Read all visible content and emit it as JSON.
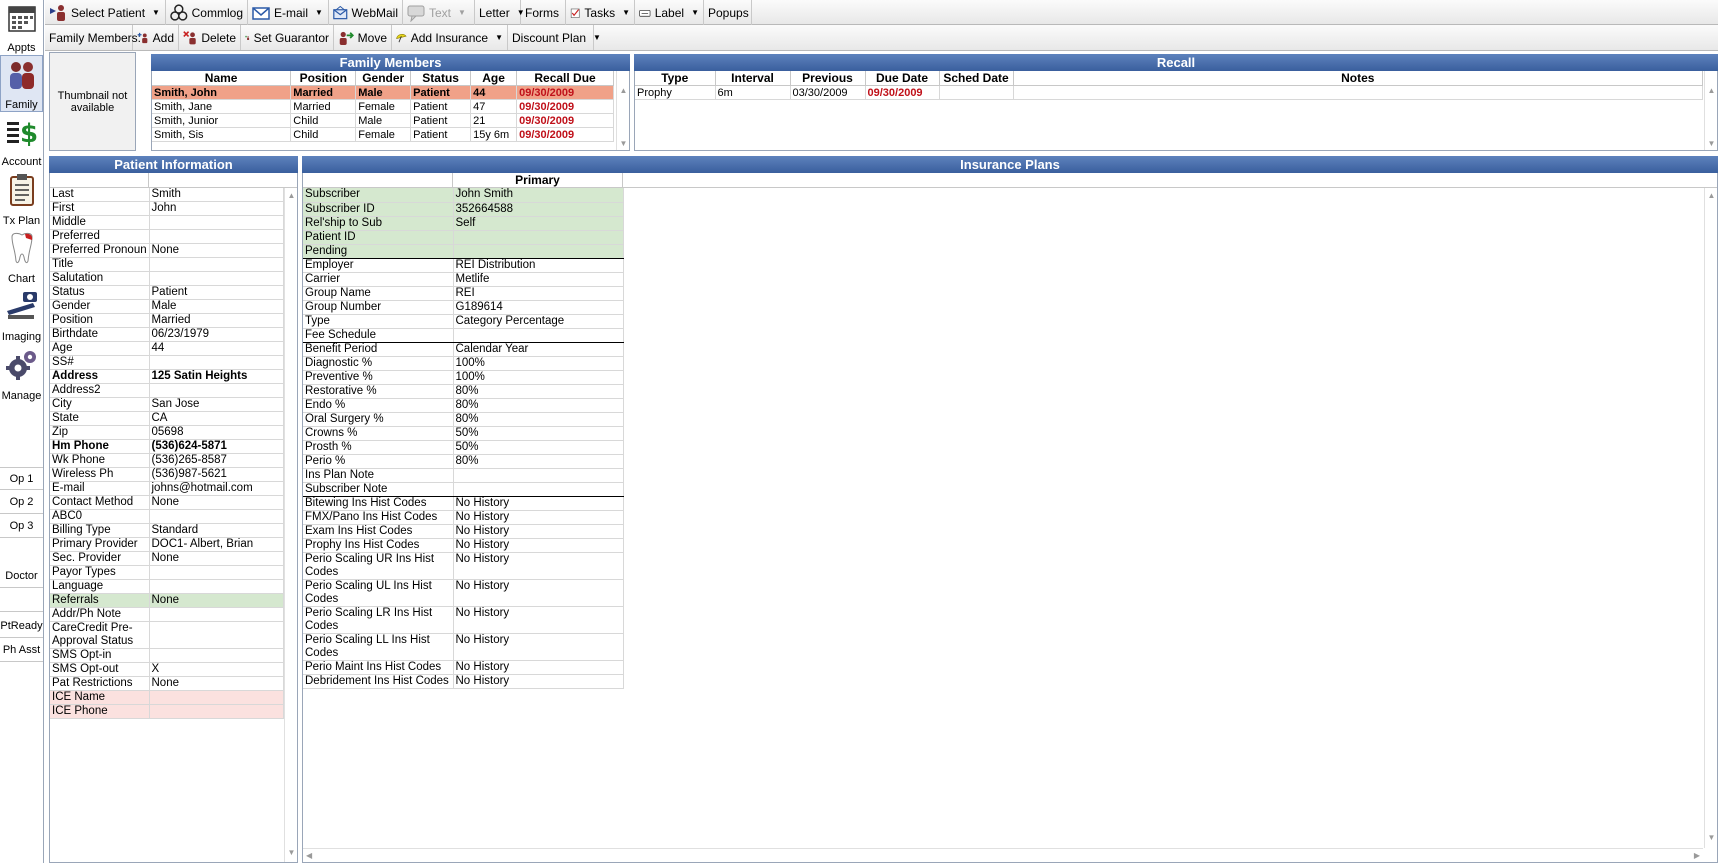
{
  "modules": [
    {
      "label": "Appts",
      "icon": "calendar-icon"
    },
    {
      "label": "Family",
      "icon": "family-icon"
    },
    {
      "label": "Account",
      "icon": "dollar-icon"
    },
    {
      "label": "Tx Plan",
      "icon": "clipboard-icon"
    },
    {
      "label": "Chart",
      "icon": "tooth-icon"
    },
    {
      "label": "Imaging",
      "icon": "camera-icon"
    },
    {
      "label": "Manage",
      "icon": "gears-icon"
    }
  ],
  "side_buttons": [
    "Op 1",
    "Op 2",
    "Op 3",
    "Doctor",
    "PtReady",
    "Ph Asst"
  ],
  "toolbar1": {
    "select_patient": "Select Patient",
    "commlog": "Commlog",
    "email": "E-mail",
    "webmail": "WebMail",
    "text": "Text",
    "letter": "Letter",
    "forms": "Forms",
    "tasks": "Tasks",
    "label": "Label",
    "popups": "Popups"
  },
  "toolbar2": {
    "family_members": "Family Members:",
    "add": "Add",
    "delete": "Delete",
    "set_guarantor": "Set Guarantor",
    "move": "Move",
    "add_insurance": "Add Insurance",
    "discount_plan": "Discount Plan"
  },
  "thumbnail_text": "Thumbnail not available",
  "family": {
    "title": "Family Members",
    "columns": [
      "Name",
      "Position",
      "Gender",
      "Status",
      "Age",
      "Recall Due"
    ],
    "rows": [
      [
        "Smith, John",
        "Married",
        "Male",
        "Patient",
        "44",
        "09/30/2009"
      ],
      [
        "Smith, Jane",
        "Married",
        "Female",
        "Patient",
        "47",
        "09/30/2009"
      ],
      [
        "Smith, Junior",
        "Child",
        "Male",
        "Patient",
        "21",
        "09/30/2009"
      ],
      [
        "Smith, Sis",
        "Child",
        "Female",
        "Patient",
        "15y 6m",
        "09/30/2009"
      ]
    ]
  },
  "recall": {
    "title": "Recall",
    "columns": [
      "Type",
      "Interval",
      "Previous",
      "Due Date",
      "Sched Date",
      "Notes"
    ],
    "rows": [
      [
        "Prophy",
        "6m",
        "03/30/2009",
        "09/30/2009",
        "",
        ""
      ]
    ]
  },
  "patient_info": {
    "title": "Patient Information",
    "rows": [
      {
        "k": "Last",
        "v": "Smith"
      },
      {
        "k": "First",
        "v": "John"
      },
      {
        "k": "Middle",
        "v": ""
      },
      {
        "k": "Preferred",
        "v": ""
      },
      {
        "k": "Preferred Pronoun",
        "v": "None"
      },
      {
        "k": "Title",
        "v": ""
      },
      {
        "k": "Salutation",
        "v": ""
      },
      {
        "k": "Status",
        "v": "Patient"
      },
      {
        "k": "Gender",
        "v": "Male"
      },
      {
        "k": "Position",
        "v": "Married"
      },
      {
        "k": "Birthdate",
        "v": "06/23/1979"
      },
      {
        "k": "Age",
        "v": "44"
      },
      {
        "k": "SS#",
        "v": ""
      },
      {
        "k": "Address",
        "v": "125 Satin Heights",
        "style": "bold"
      },
      {
        "k": "Address2",
        "v": ""
      },
      {
        "k": "City",
        "v": "San Jose"
      },
      {
        "k": "State",
        "v": "CA"
      },
      {
        "k": "Zip",
        "v": "05698"
      },
      {
        "k": "Hm Phone",
        "v": "(536)624-5871",
        "style": "bold"
      },
      {
        "k": "Wk Phone",
        "v": "(536)265-8587"
      },
      {
        "k": "Wireless Ph",
        "v": "(536)987-5621"
      },
      {
        "k": "E-mail",
        "v": "johns@hotmail.com"
      },
      {
        "k": "Contact Method",
        "v": "None"
      },
      {
        "k": "ABC0",
        "v": ""
      },
      {
        "k": "Billing Type",
        "v": "Standard"
      },
      {
        "k": "Primary Provider",
        "v": "DOC1- Albert, Brian"
      },
      {
        "k": "Sec. Provider",
        "v": "None"
      },
      {
        "k": "Payor Types",
        "v": ""
      },
      {
        "k": "Language",
        "v": ""
      },
      {
        "k": "Referrals",
        "v": "None",
        "style": "green"
      },
      {
        "k": "Addr/Ph Note",
        "v": ""
      },
      {
        "k": "CareCredit Pre-Approval Status",
        "v": "",
        "tall": true
      },
      {
        "k": "SMS Opt-in",
        "v": ""
      },
      {
        "k": "SMS Opt-out",
        "v": "X"
      },
      {
        "k": "Pat Restrictions",
        "v": "None"
      },
      {
        "k": "ICE Name",
        "v": "",
        "style": "pink"
      },
      {
        "k": "ICE Phone",
        "v": "",
        "style": "pink"
      }
    ]
  },
  "insurance": {
    "title": "Insurance Plans",
    "column": "Primary",
    "rows": [
      {
        "k": "Subscriber",
        "v": "John Smith",
        "style": "green"
      },
      {
        "k": "Subscriber ID",
        "v": "352664588",
        "style": "green"
      },
      {
        "k": "Rel'ship to Sub",
        "v": "Self",
        "style": "green"
      },
      {
        "k": "Patient ID",
        "v": "",
        "style": "green"
      },
      {
        "k": "Pending",
        "v": "",
        "style": "green",
        "sep": true
      },
      {
        "k": "Employer",
        "v": "REI Distribution"
      },
      {
        "k": "Carrier",
        "v": "Metlife"
      },
      {
        "k": "Group Name",
        "v": "REI"
      },
      {
        "k": "Group Number",
        "v": "G189614"
      },
      {
        "k": "Type",
        "v": "Category Percentage"
      },
      {
        "k": "Fee Schedule",
        "v": "",
        "sep": true
      },
      {
        "k": "Benefit Period",
        "v": "Calendar Year"
      },
      {
        "k": "Diagnostic %",
        "v": "100%"
      },
      {
        "k": "Preventive %",
        "v": "100%"
      },
      {
        "k": "Restorative %",
        "v": "80%"
      },
      {
        "k": "Endo %",
        "v": "80%"
      },
      {
        "k": "Oral Surgery %",
        "v": "80%"
      },
      {
        "k": "Crowns %",
        "v": "50%"
      },
      {
        "k": "Prosth %",
        "v": "50%"
      },
      {
        "k": "Perio %",
        "v": "80%"
      },
      {
        "k": "Ins Plan Note",
        "v": ""
      },
      {
        "k": "Subscriber Note",
        "v": "",
        "sep": true
      },
      {
        "k": "Bitewing Ins Hist Codes",
        "v": "No History"
      },
      {
        "k": "FMX/Pano Ins Hist Codes",
        "v": "No History"
      },
      {
        "k": "Exam Ins Hist Codes",
        "v": "No History"
      },
      {
        "k": "Prophy Ins Hist Codes",
        "v": "No History"
      },
      {
        "k": "Perio Scaling UR Ins Hist Codes",
        "v": "No History",
        "tall": true
      },
      {
        "k": "Perio Scaling UL Ins Hist Codes",
        "v": "No History",
        "tall": true
      },
      {
        "k": "Perio Scaling LR Ins Hist Codes",
        "v": "No History",
        "tall": true
      },
      {
        "k": "Perio Scaling LL Ins Hist Codes",
        "v": "No History",
        "tall": true
      },
      {
        "k": "Perio Maint Ins Hist Codes",
        "v": "No History"
      },
      {
        "k": "Debridement Ins Hist Codes",
        "v": "No History"
      }
    ]
  }
}
